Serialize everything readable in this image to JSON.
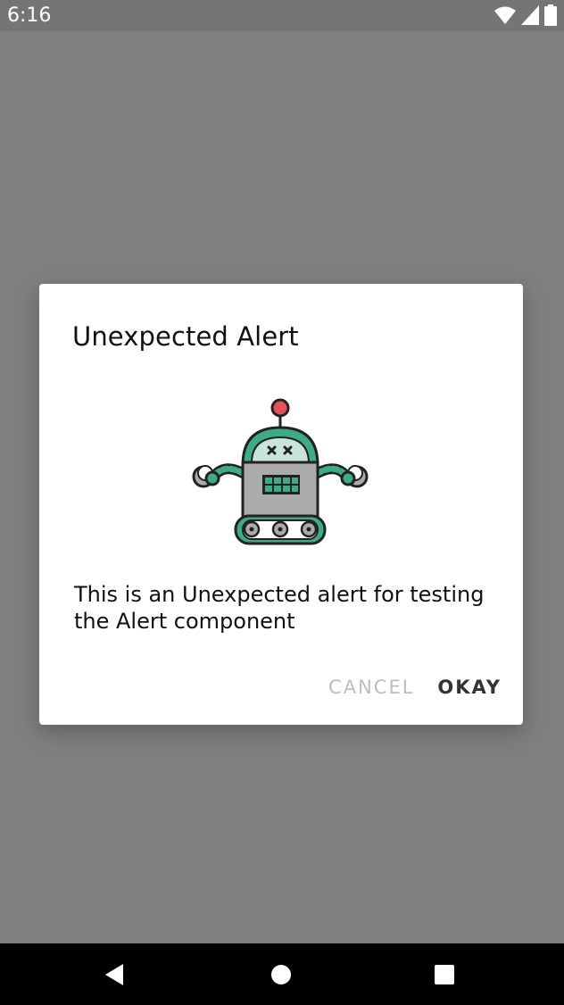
{
  "status_bar": {
    "time": "6:16"
  },
  "dialog": {
    "title": "Unexpected Alert",
    "message": "This is an Unexpected alert for testing the Alert component",
    "buttons": {
      "cancel": "CANCEL",
      "okay": "OKAY"
    }
  },
  "colors": {
    "scrim": "#7f7f7f",
    "robot_green": "#3dab87",
    "robot_light": "#c9e4da",
    "robot_gray": "#ababab",
    "antenna_red": "#e5505a",
    "cancel_disabled": "#bdbdbd"
  },
  "icons": {
    "status": [
      "wifi-icon",
      "signal-icon",
      "battery-icon"
    ],
    "illustration": "robot-icon",
    "nav": [
      "back-icon",
      "home-icon",
      "recents-icon"
    ]
  }
}
